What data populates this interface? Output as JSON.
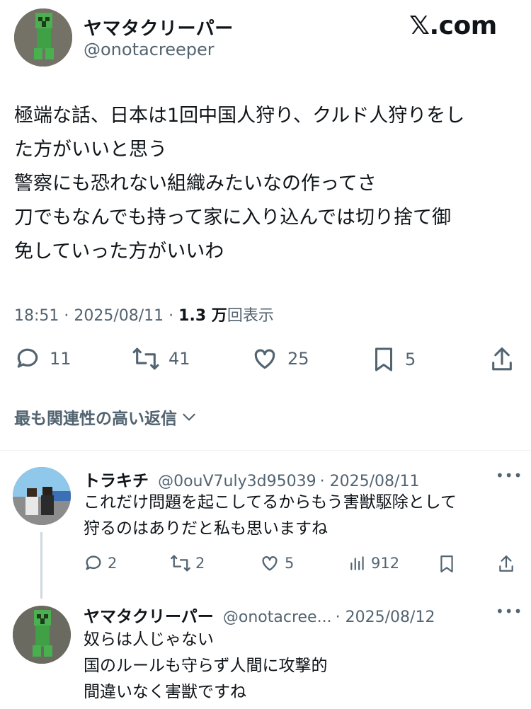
{
  "header": {
    "display_name": "ヤマタクリーパー",
    "handle": "@onotacreeper",
    "brand": "𝕏.com"
  },
  "tweet": {
    "lines": [
      "極端な話、日本は1回中国人狩り、クルド人狩りをし",
      "た方がいいと思う",
      "警察にも恐れない組織みたいなの作ってさ",
      "刀でもなんでも持って家に入り込んでは切り捨て御",
      "免していった方がいいわ"
    ],
    "time": "18:51 · 2025/08/11 · ",
    "views_count": "1.3 万",
    "views_label": "回表示"
  },
  "actions": {
    "replies": "11",
    "reposts": "41",
    "likes": "25",
    "bookmarks": "5"
  },
  "sort": {
    "label": "最も関連性の高い返信"
  },
  "replies": [
    {
      "name": "トラキチ",
      "handle": "@0ouV7uly3d95039",
      "date": "· 2025/08/11",
      "lines": [
        "これだけ問題を起こしてるからもう害獣駆除として",
        "狩るのはありだと私も思いますね"
      ],
      "stats": {
        "replies": "2",
        "reposts": "2",
        "likes": "5",
        "views": "912"
      }
    },
    {
      "name": "ヤマタクリーパー",
      "handle": "@onotacree...",
      "date": "· 2025/08/12",
      "lines": [
        "奴らは人じゃない",
        "国のルールも守らず人間に攻撃的",
        "間違いなく害獣ですね"
      ]
    }
  ],
  "colors": {
    "text": "#0f1419",
    "secondary": "#536471",
    "divider": "#eff3f4",
    "creeper_green": "#4caf50"
  },
  "icons": [
    "reply-icon",
    "repost-icon",
    "like-icon",
    "bookmark-icon",
    "share-icon",
    "views-icon",
    "chevron-down-icon",
    "more-icon"
  ]
}
